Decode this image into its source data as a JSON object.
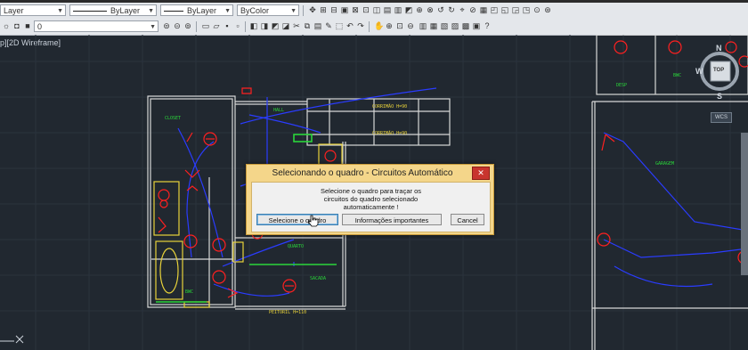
{
  "toolbar": {
    "layer_combo": "Layer",
    "linetype_combo": "ByLayer",
    "lineweight_combo": "ByLayer",
    "color_combo": "ByColor",
    "layer_value": "0"
  },
  "viewport": {
    "label": "p][2D Wireframe]"
  },
  "plan_labels": {
    "closet": "CLOSET",
    "hall": "HALL",
    "corridor_1": "CORRIMÃO H=90",
    "corridor_2": "CORRIMÃO H=90",
    "quarto": "QUARTO",
    "bwc_left": "BWC",
    "sacada": "SACADA",
    "peitoril": "PEITORIL H=110",
    "desp": "DESP",
    "bwc_right": "BWC",
    "garagem": "GARAGEM"
  },
  "dialog": {
    "title": "Selecionando o quadro - Circuitos Automático",
    "close_label": "✕",
    "message_line1": "Selecione o quadro para traçar os",
    "message_line2": "circuitos do quadro selecionado",
    "message_line3": "automaticamente !",
    "btn_select": "Selecione o quadro",
    "btn_info": "Informações importantes",
    "btn_cancel": "Cancel"
  },
  "compass": {
    "north": "N",
    "south": "S",
    "west": "W",
    "top": "TOP",
    "wcs": "WCS"
  },
  "colors": {
    "background": "#212830",
    "wall": "#e8e8e8",
    "red": "#ff2020",
    "blue": "#2a3cff",
    "yellow": "#e8d23a",
    "green": "#2ad63a",
    "dialog_frame": "#f4d68a"
  }
}
